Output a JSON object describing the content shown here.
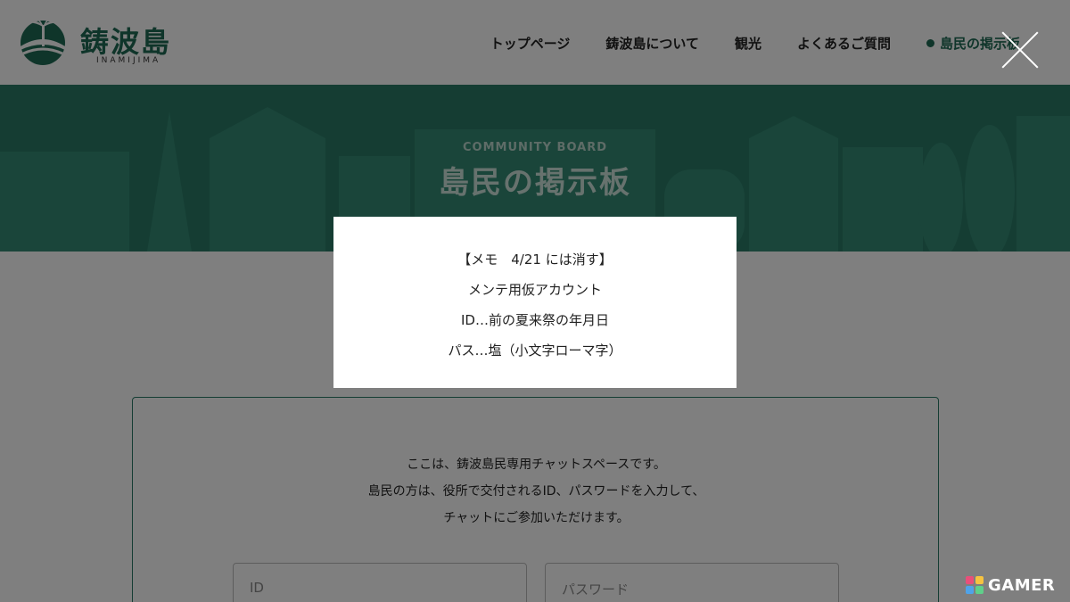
{
  "header": {
    "logo_text": "鋳波島",
    "logo_sub": "INAMIJIMA",
    "nav": [
      {
        "label": "トップページ"
      },
      {
        "label": "鋳波島について"
      },
      {
        "label": "観光"
      },
      {
        "label": "よくあるご質問"
      },
      {
        "label": "島民の掲示板"
      }
    ]
  },
  "hero": {
    "subtitle": "COMMUNITY BOARD",
    "title": "島民の掲示板"
  },
  "board": {
    "intro_lines": [
      "ここは、鋳波島民専用チャットスペースです。",
      "島民の方は、役所で交付されるID、パスワードを入力して、",
      "チャットにご参加いただけます。"
    ],
    "id_placeholder": "ID",
    "password_placeholder": "パスワード"
  },
  "memo": {
    "lines": [
      "【メモ　4/21 には消す】",
      "メンテ用仮アカウント",
      "ID…前の夏来祭の年月日",
      "パス…塩（小文字ローマ字）"
    ]
  },
  "icons": {
    "close": "close-icon",
    "logo": "palm-island-logo-icon",
    "active_nav": "dot-icon"
  },
  "watermark": {
    "text": "GAMER"
  },
  "colors": {
    "brand_green": "#1f6b55",
    "hero_green": "#2a7a66",
    "overlay": "rgba(0,0,0,0.5)"
  }
}
